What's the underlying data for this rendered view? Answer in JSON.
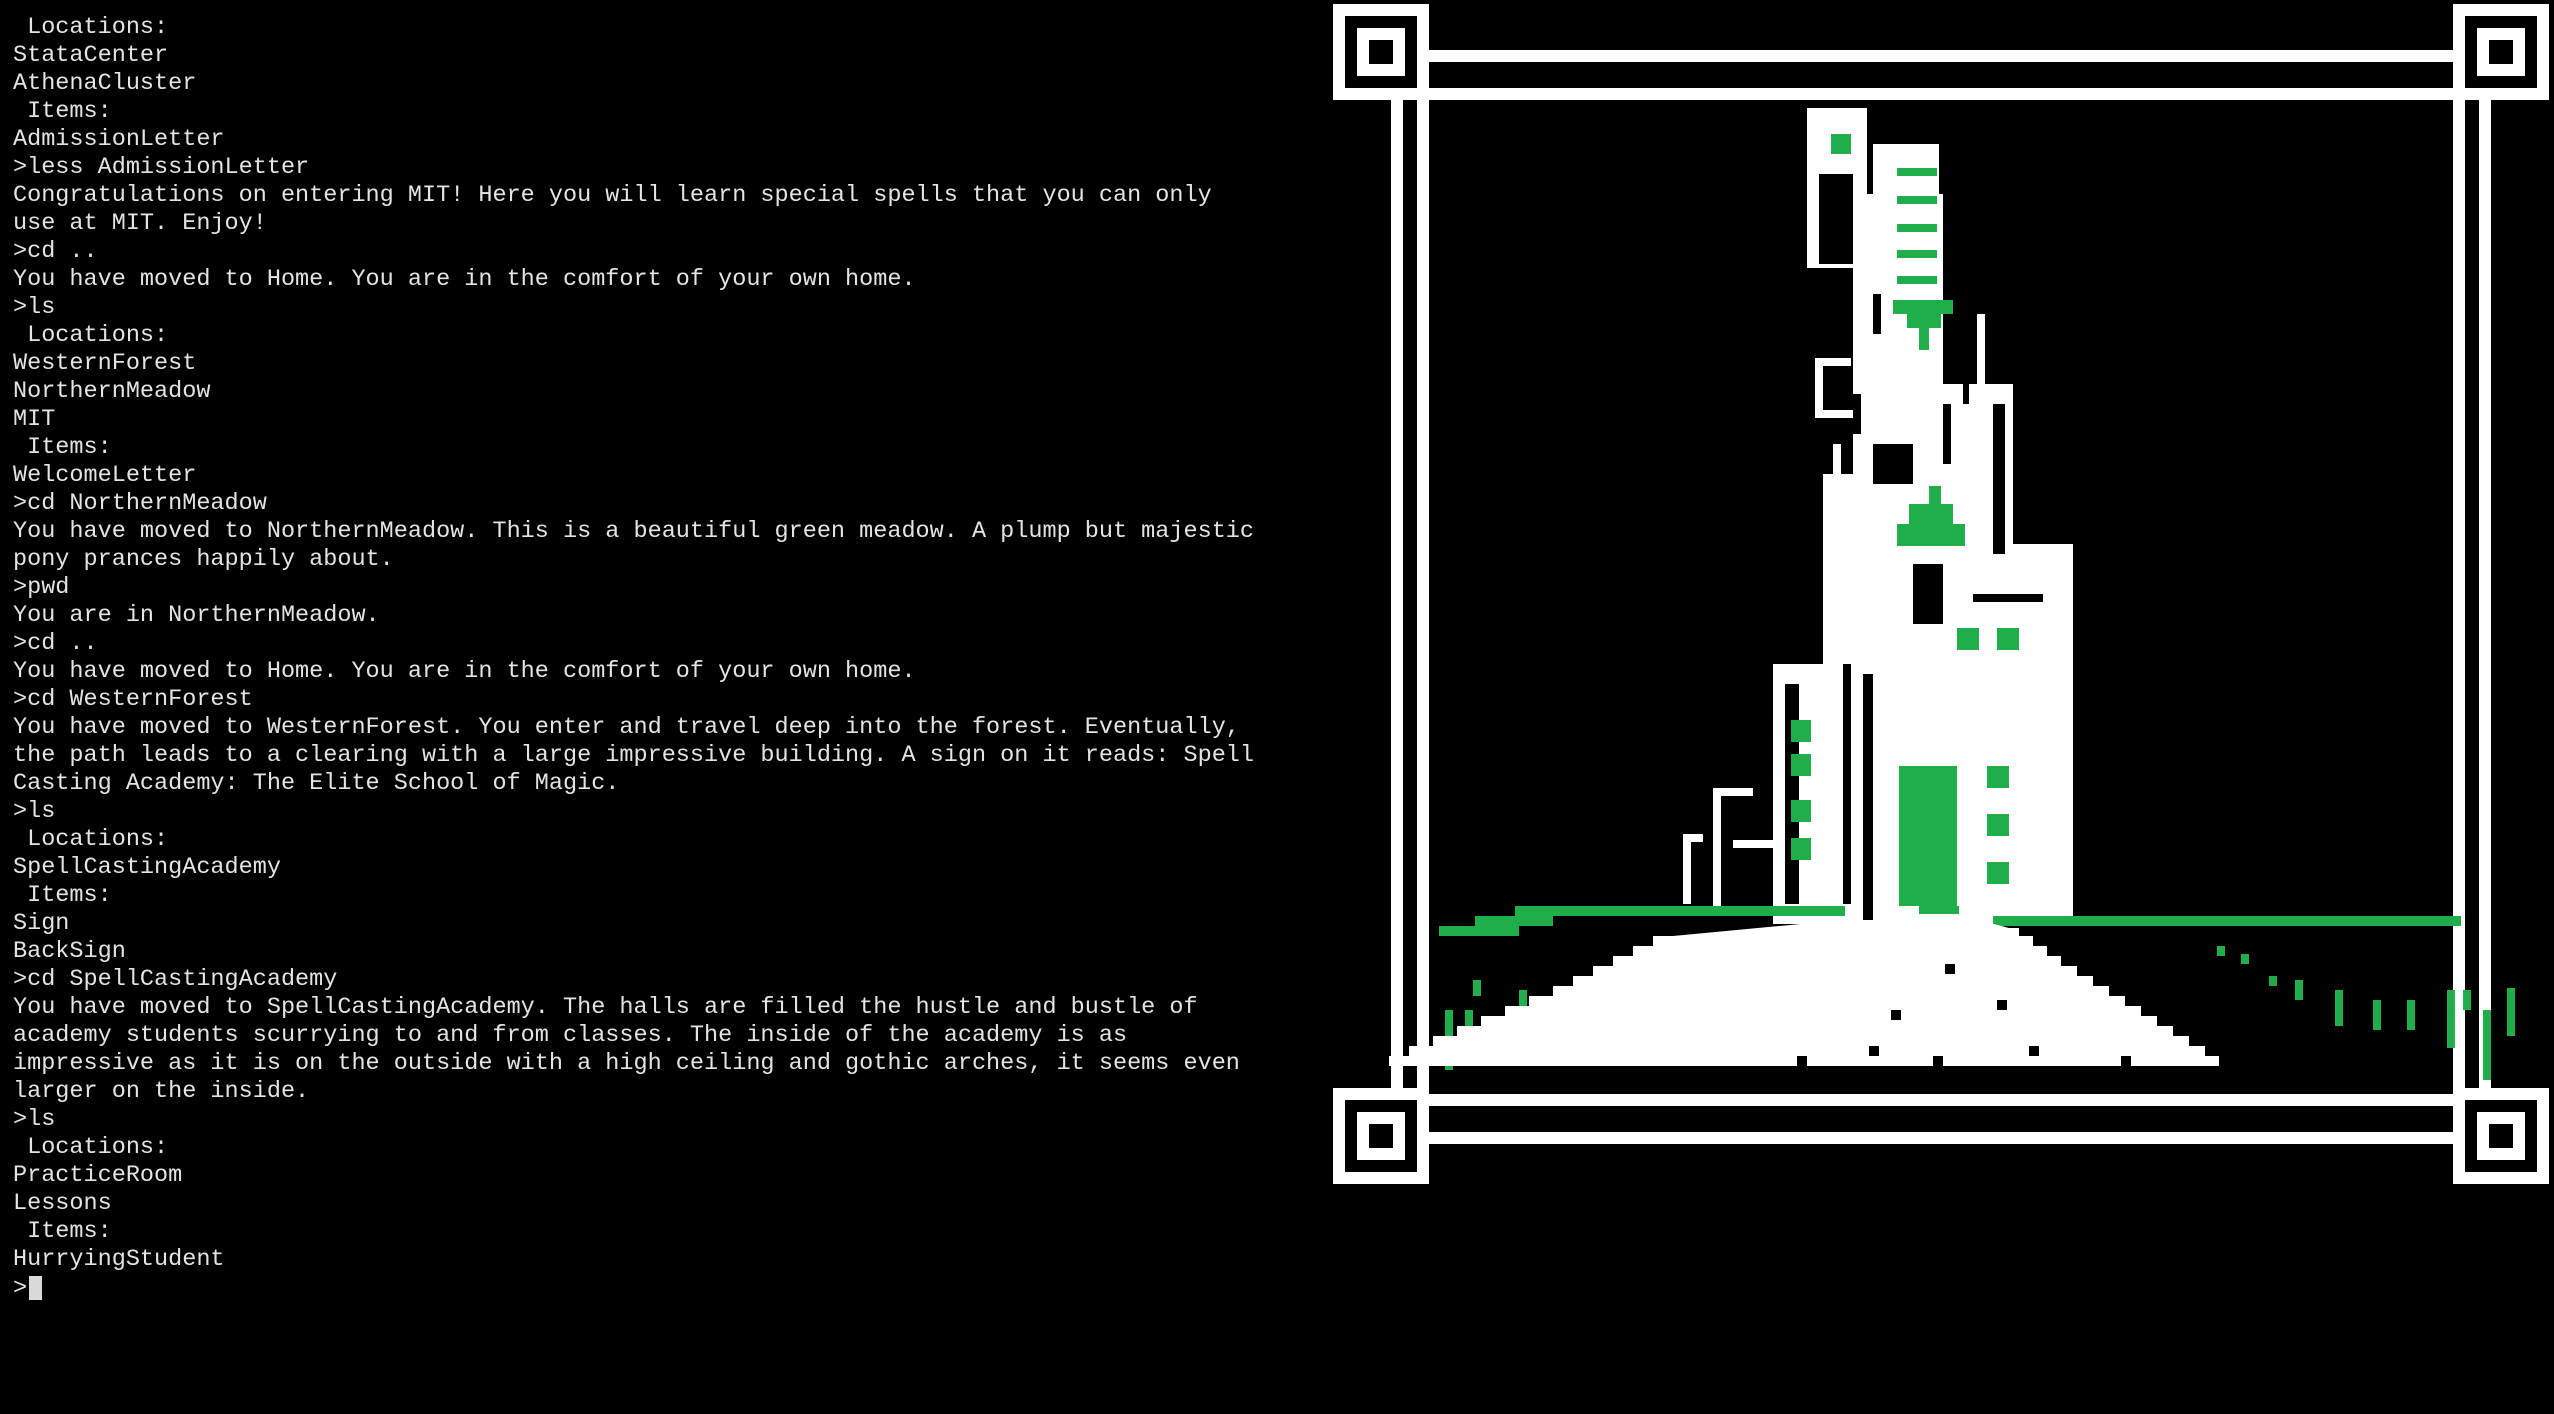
{
  "terminal": {
    "lines": [
      {
        "text": " Locations:",
        "kind": "out"
      },
      {
        "text": "StataCenter",
        "kind": "out"
      },
      {
        "text": "AthenaCluster",
        "kind": "out"
      },
      {
        "text": " Items:",
        "kind": "out"
      },
      {
        "text": "AdmissionLetter",
        "kind": "out"
      },
      {
        "text": ">less AdmissionLetter",
        "kind": "cmd"
      },
      {
        "text": "Congratulations on entering MIT! Here you will learn special spells that you can only",
        "kind": "out"
      },
      {
        "text": "use at MIT. Enjoy!",
        "kind": "out"
      },
      {
        "text": ">cd ..",
        "kind": "cmd"
      },
      {
        "text": "You have moved to Home. You are in the comfort of your own home.",
        "kind": "out"
      },
      {
        "text": ">ls",
        "kind": "cmd"
      },
      {
        "text": " Locations:",
        "kind": "out"
      },
      {
        "text": "WesternForest",
        "kind": "out"
      },
      {
        "text": "NorthernMeadow",
        "kind": "out"
      },
      {
        "text": "MIT",
        "kind": "out"
      },
      {
        "text": " Items:",
        "kind": "out"
      },
      {
        "text": "WelcomeLetter",
        "kind": "out"
      },
      {
        "text": ">cd NorthernMeadow",
        "kind": "cmd"
      },
      {
        "text": "You have moved to NorthernMeadow. This is a beautiful green meadow. A plump but majestic",
        "kind": "out"
      },
      {
        "text": "pony prances happily about.",
        "kind": "out"
      },
      {
        "text": ">pwd",
        "kind": "cmd"
      },
      {
        "text": "You are in NorthernMeadow.",
        "kind": "out"
      },
      {
        "text": ">cd ..",
        "kind": "cmd"
      },
      {
        "text": "You have moved to Home. You are in the comfort of your own home.",
        "kind": "out"
      },
      {
        "text": ">cd WesternForest",
        "kind": "cmd"
      },
      {
        "text": "You have moved to WesternForest. You enter and travel deep into the forest. Eventually,",
        "kind": "out"
      },
      {
        "text": "the path leads to a clearing with a large impressive building. A sign on it reads: Spell",
        "kind": "out"
      },
      {
        "text": "Casting Academy: The Elite School of Magic.",
        "kind": "out"
      },
      {
        "text": ">ls",
        "kind": "cmd"
      },
      {
        "text": " Locations:",
        "kind": "out"
      },
      {
        "text": "SpellCastingAcademy",
        "kind": "out"
      },
      {
        "text": " Items:",
        "kind": "out"
      },
      {
        "text": "Sign",
        "kind": "out"
      },
      {
        "text": "BackSign",
        "kind": "out"
      },
      {
        "text": ">cd SpellCastingAcademy",
        "kind": "cmd"
      },
      {
        "text": "You have moved to SpellCastingAcademy. The halls are filled the hustle and bustle of",
        "kind": "out"
      },
      {
        "text": "academy students scurrying to and from classes. The inside of the academy is as",
        "kind": "out"
      },
      {
        "text": "impressive as it is on the outside with a high ceiling and gothic arches, it seems even",
        "kind": "out"
      },
      {
        "text": "larger on the inside.",
        "kind": "out"
      },
      {
        "text": ">ls",
        "kind": "cmd"
      },
      {
        "text": " Locations:",
        "kind": "out"
      },
      {
        "text": "PracticeRoom",
        "kind": "out"
      },
      {
        "text": "Lessons",
        "kind": "out"
      },
      {
        "text": " Items:",
        "kind": "out"
      },
      {
        "text": "HurryingStudent",
        "kind": "out"
      }
    ],
    "prompt": ">"
  },
  "art": {
    "name": "spell-casting-academy-pixel-art",
    "colors": {
      "frame": "#ffffff",
      "accent": "#1fae4a",
      "background": "#000000"
    }
  }
}
